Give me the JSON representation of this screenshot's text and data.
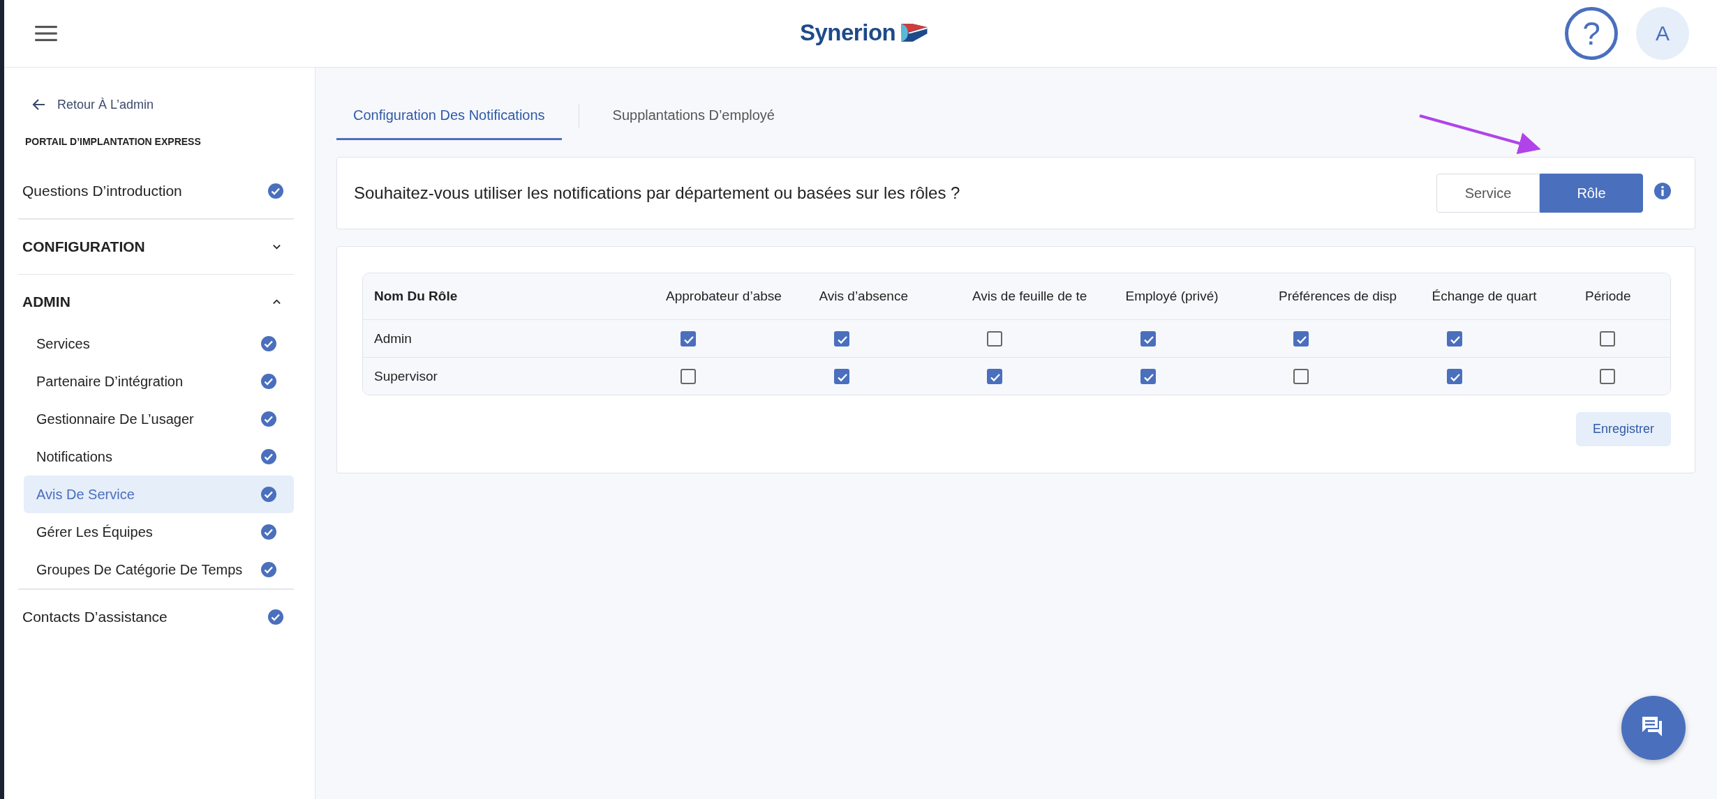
{
  "header": {
    "logo": "Synerion",
    "help": "?",
    "avatar": "A"
  },
  "sidebar": {
    "back": "Retour À L’admin",
    "portal_title": "PORTAIL D’IMPLANTATION EXPRESS",
    "sections": [
      {
        "kind": "item",
        "label": "Questions D’introduction",
        "done": true
      },
      {
        "kind": "group",
        "label": "CONFIGURATION",
        "expanded": false
      },
      {
        "kind": "group",
        "label": "ADMIN",
        "expanded": true,
        "children": [
          {
            "label": "Services",
            "done": true,
            "selected": false
          },
          {
            "label": "Partenaire D’intégration",
            "done": true,
            "selected": false
          },
          {
            "label": "Gestionnaire De L’usager",
            "done": true,
            "selected": false
          },
          {
            "label": "Notifications",
            "done": true,
            "selected": false
          },
          {
            "label": "Avis De Service",
            "done": true,
            "selected": true
          },
          {
            "label": "Gérer Les Équipes",
            "done": true,
            "selected": false
          },
          {
            "label": "Groupes De Catégorie De Temps",
            "done": true,
            "selected": false
          }
        ]
      },
      {
        "kind": "item",
        "label": "Contacts D’assistance",
        "done": true
      }
    ]
  },
  "tabs": [
    {
      "label": "Configuration Des Notifications",
      "selected": true
    },
    {
      "label": "Supplantations D’employé",
      "selected": false
    }
  ],
  "question": {
    "text": "Souhaitez-vous utiliser les notifications par département ou basées sur les rôles ?",
    "options": [
      {
        "label": "Service",
        "selected": false
      },
      {
        "label": "Rôle",
        "selected": true
      }
    ]
  },
  "table": {
    "columns": [
      "Nom Du Rôle",
      "Approbateur d’abse",
      "Avis d’absence",
      "Avis de feuille de te",
      "Employé (privé)",
      "Préférences de disp",
      "Échange de quart",
      "Période"
    ],
    "rows": [
      {
        "name": "Admin",
        "checks": [
          true,
          true,
          false,
          true,
          true,
          true,
          false
        ]
      },
      {
        "name": "Supervisor",
        "checks": [
          false,
          true,
          true,
          true,
          false,
          true,
          false
        ]
      }
    ]
  },
  "save_button": "Enregistrer"
}
